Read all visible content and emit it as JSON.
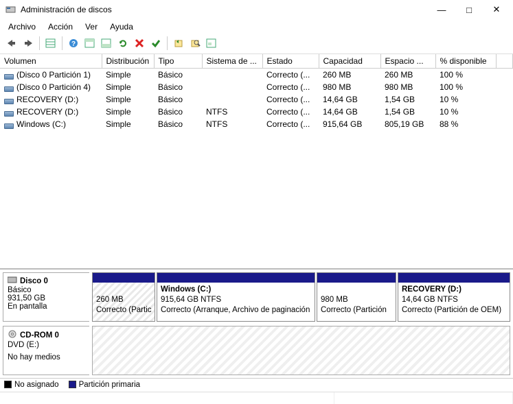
{
  "window": {
    "title": "Administración de discos"
  },
  "menu": {
    "file": "Archivo",
    "action": "Acción",
    "view": "Ver",
    "help": "Ayuda"
  },
  "columns": {
    "volume": "Volumen",
    "layout": "Distribución",
    "type": "Tipo",
    "fs": "Sistema de ...",
    "status": "Estado",
    "capacity": "Capacidad",
    "free": "Espacio ...",
    "pct": "% disponible"
  },
  "volumes": [
    {
      "name": "(Disco 0 Partición 1)",
      "layout": "Simple",
      "type": "Básico",
      "fs": "",
      "status": "Correcto (...",
      "capacity": "260 MB",
      "free": "260 MB",
      "pct": "100 %"
    },
    {
      "name": "(Disco 0 Partición 4)",
      "layout": "Simple",
      "type": "Básico",
      "fs": "",
      "status": "Correcto (...",
      "capacity": "980 MB",
      "free": "980 MB",
      "pct": "100 %"
    },
    {
      "name": "RECOVERY (D:)",
      "layout": "Simple",
      "type": "Básico",
      "fs": "",
      "status": "Correcto (...",
      "capacity": "14,64 GB",
      "free": "1,54 GB",
      "pct": "10 %"
    },
    {
      "name": "RECOVERY (D:)",
      "layout": "Simple",
      "type": "Básico",
      "fs": "NTFS",
      "status": "Correcto (...",
      "capacity": "14,64 GB",
      "free": "1,54 GB",
      "pct": "10 %"
    },
    {
      "name": "Windows (C:)",
      "layout": "Simple",
      "type": "Básico",
      "fs": "NTFS",
      "status": "Correcto (...",
      "capacity": "915,64 GB",
      "free": "805,19 GB",
      "pct": "88 %"
    }
  ],
  "disk0": {
    "name": "Disco 0",
    "type": "Básico",
    "size": "931,50 GB",
    "status": "En pantalla",
    "p1_size": "260 MB",
    "p1_status": "Correcto (Partic",
    "p2_name": "Windows  (C:)",
    "p2_sub": "915,64 GB NTFS",
    "p2_status": "Correcto (Arranque, Archivo de paginación",
    "p3_size": "980 MB",
    "p3_status": "Correcto (Partición",
    "p4_name": "RECOVERY  (D:)",
    "p4_sub": "14,64 GB NTFS",
    "p4_status": "Correcto (Partición de OEM)"
  },
  "cdrom": {
    "name": "CD-ROM 0",
    "sub": "DVD (E:)",
    "status": "No hay medios"
  },
  "legend": {
    "unallocated": "No asignado",
    "primary": "Partición primaria"
  }
}
